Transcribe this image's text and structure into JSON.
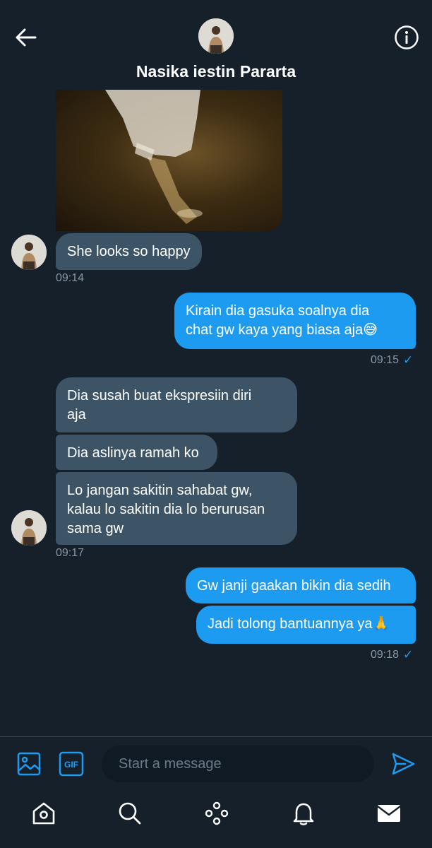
{
  "header": {
    "contact_name": "Nasika iestin Pararta",
    "back_icon": "arrow-left-icon",
    "info_icon": "info-icon"
  },
  "messages": [
    {
      "side": "incoming",
      "type": "image"
    },
    {
      "side": "incoming",
      "text": "She looks so happy"
    },
    {
      "side": "outgoing",
      "text": "Kirain dia gasuka soalnya dia\nchat gw kaya yang biasa aja😅"
    },
    {
      "side": "incoming",
      "text": "Dia susah buat ekspresiin diri\naja"
    },
    {
      "side": "incoming",
      "text": "Dia aslinya ramah ko"
    },
    {
      "side": "incoming",
      "text": "Lo jangan sakitin sahabat gw,\nkalau lo sakitin dia lo berurusan\nsama gw"
    },
    {
      "side": "outgoing",
      "text": "Gw janji gaakan bikin dia sedih"
    },
    {
      "side": "outgoing",
      "text": "Jadi tolong bantuannya ya🙏"
    }
  ],
  "timestamps": {
    "t1": "09:14",
    "t2": "09:15",
    "t3": "09:17",
    "t4": "09:18",
    "read_mark": "✓"
  },
  "composer": {
    "placeholder": "Start a message",
    "gif_label": "GIF",
    "icons": [
      "image-icon",
      "gif-icon",
      "send-icon"
    ]
  },
  "nav": {
    "items": [
      "home-icon",
      "search-icon",
      "spaces-icon",
      "notifications-icon",
      "messages-icon"
    ]
  },
  "colors": {
    "background": "#15202b",
    "incoming_bubble": "#3d5466",
    "outgoing_bubble": "#1d9bf0",
    "muted_text": "#8b98a5",
    "accent": "#1d9bf0"
  }
}
